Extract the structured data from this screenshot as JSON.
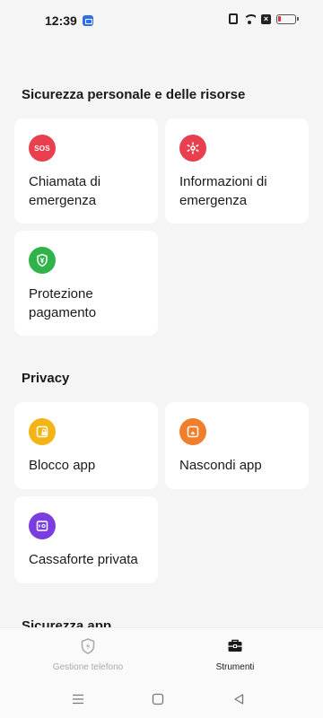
{
  "status_bar": {
    "time": "12:39",
    "icons": [
      "notification-app-icon",
      "nfc-icon",
      "wifi-icon",
      "x-icon",
      "battery-low-icon"
    ]
  },
  "sections": {
    "personal": {
      "title": "Sicurezza personale e delle risorse",
      "cards": [
        {
          "label": "Chiamata di emergenza",
          "icon": "sos-icon",
          "icon_text": "SOS",
          "color": "#e8404e"
        },
        {
          "label": "Informazioni di emergenza",
          "icon": "medical-asterisk-icon",
          "color": "#e8404e"
        },
        {
          "label": "Protezione pagamento",
          "icon": "payment-shield-icon",
          "color": "#2fb34a"
        }
      ]
    },
    "privacy": {
      "title": "Privacy",
      "cards": [
        {
          "label": "Blocco app",
          "icon": "app-lock-icon",
          "color": "#f5b416"
        },
        {
          "label": "Nascondi app",
          "icon": "hide-app-icon",
          "color": "#f07e2a"
        },
        {
          "label": "Cassaforte privata",
          "icon": "private-safe-icon",
          "color": "#7a3ee0"
        }
      ]
    },
    "app_security": {
      "title": "Sicurezza app"
    }
  },
  "bottom_nav": {
    "items": [
      {
        "label": "Gestione telefono",
        "icon": "shield-bolt-icon",
        "active": false
      },
      {
        "label": "Strumenti",
        "icon": "toolbox-icon",
        "active": true
      }
    ]
  },
  "colors": {
    "background": "#f5f5f5",
    "card": "#ffffff",
    "sos_red": "#e8404e",
    "green": "#2fb34a",
    "yellow": "#f5b416",
    "orange": "#f07e2a",
    "purple": "#7a3ee0"
  }
}
